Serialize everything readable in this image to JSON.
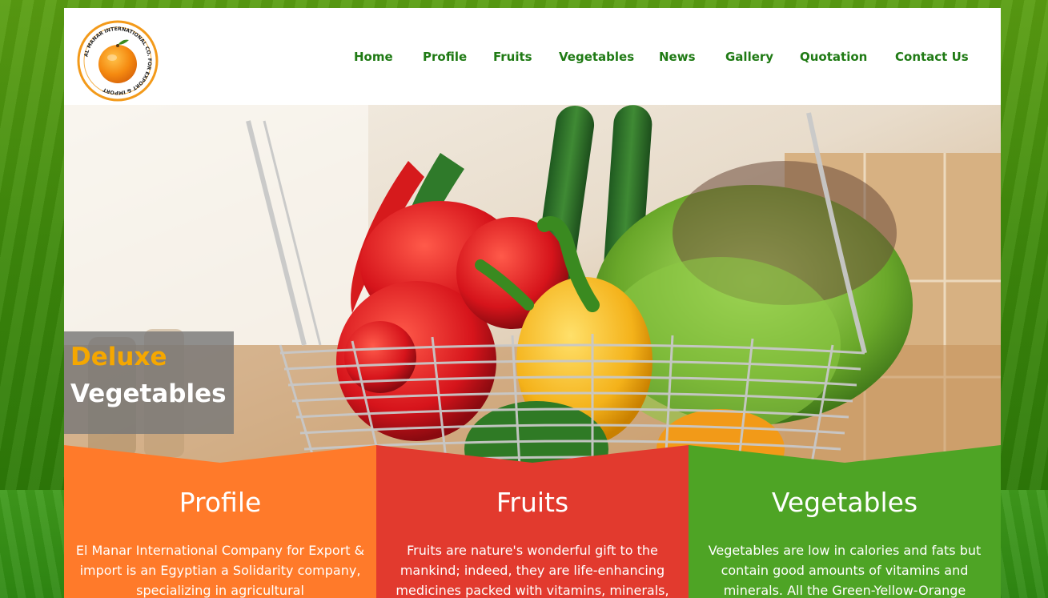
{
  "brand": {
    "logo_alt": "El Manar International Co. for Export & Import logo",
    "logo_text_top": "AL MANAR INTERNATIONAL CO. FOR EXPORT & IMPORT"
  },
  "nav": {
    "items": [
      {
        "label": "Home"
      },
      {
        "label": "Profile"
      },
      {
        "label": "Fruits"
      },
      {
        "label": "Vegetables"
      },
      {
        "label": "News"
      },
      {
        "label": "Gallery"
      },
      {
        "label": "Quotation"
      },
      {
        "label": "Contact Us"
      }
    ]
  },
  "hero": {
    "caption_line1": "Deluxe",
    "caption_line2": "Vegetables"
  },
  "panels": [
    {
      "title": "Profile",
      "text": "El Manar International Company for Export & import is an Egyptian a Solidarity company, specializing in agricultural",
      "color": "#ff7a2a"
    },
    {
      "title": "Fruits",
      "text": "Fruits are nature's wonderful gift to the mankind; indeed, they are life-enhancing medicines packed with vitamins, minerals,",
      "color": "#e23a2e"
    },
    {
      "title": "Vegetables",
      "text": "Vegetables are low in calories and fats but contain good amounts of vitamins and minerals. All the Green-Yellow-Orange",
      "color": "#4ea425"
    }
  ],
  "colors": {
    "nav_text": "#1f7a14",
    "caption_highlight": "#f5a700",
    "page_bg": "#3f8a0c"
  }
}
